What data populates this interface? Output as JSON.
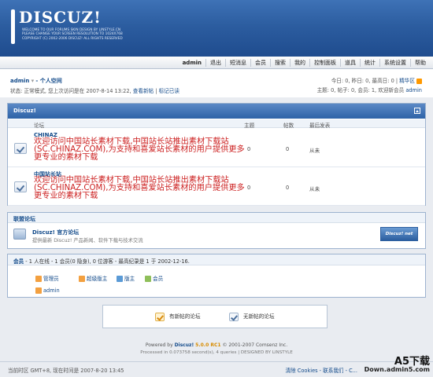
{
  "header": {
    "logo_title": "DISCUZ!",
    "logo_sub": "Welcome to our forums  Skin design by Linstyle.cn  Please change your screen resolution to 1024x768  Copyright (c) 2002-2006 Discuz! All rights reserved"
  },
  "nav": [
    "admin",
    "退出",
    "短消息",
    "会员",
    "搜索",
    "我的",
    "控制面板",
    "道具",
    "统计",
    "系统设置",
    "帮助"
  ],
  "userbar": {
    "user": "admin",
    "space": "- 个人空间",
    "status": "状态: 正常模式, 您上次访问是在 2007-8-14 13:22,",
    "link_new": "查看新帖",
    "link_read": "标记已读",
    "stats1": "今日: 0, 昨日: 0, 最高日: 0 |",
    "stats1_link": "精华区",
    "stats2": "主题: 0, 帖子: 0, 会员: 1, 欢迎新会员",
    "stats2_link": "admin"
  },
  "forum": {
    "category": "Discuz!",
    "columns": {
      "forum": "论坛",
      "topics": "主题",
      "posts": "帖数",
      "last": "最后发表"
    },
    "rows": [
      {
        "name": "CHINAZ",
        "desc": "欢迎访问中国站长素材下载,中国站长站推出素材下载站(SC.CHINAZ.COM),为支持和喜爱站长素材的用户提供更多更专业的素材下载",
        "topics": "0",
        "posts": "0",
        "last": "从未"
      },
      {
        "name": "中国站长站",
        "desc": "欢迎访问中国站长素材下载,中国站长站推出素材下载站(SC.CHINAZ.COM),为支持和喜爱站长素材的用户提供更多更专业的素材下载",
        "topics": "0",
        "posts": "0",
        "last": "从未"
      }
    ]
  },
  "league": {
    "title": "联盟论坛",
    "name": "Discuz! 官方论坛",
    "desc": "提供最新 Discuz! 产品新闻、软件下载与技术交流",
    "logo_text": "Discuz! net"
  },
  "online": {
    "label": "会员",
    "summary": "- 1 人在线 - 1 会员(0 隐身), 0 位游客 - 最高纪录是 1 于 2002-12-16.",
    "legend": [
      {
        "label": "管理员",
        "color": "#f3a040"
      },
      {
        "label": "超级版主",
        "color": "#f3a040"
      },
      {
        "label": "版主",
        "color": "#5a9ad6"
      },
      {
        "label": "会员",
        "color": "#8fbf5a"
      }
    ],
    "user": "admin"
  },
  "icon_legend": {
    "new_label": "有新帖的论坛",
    "none_label": "无新帖的论坛"
  },
  "footer": {
    "powered_pre": "Powered by",
    "powered_name": "Discuz!",
    "powered_ver": "5.0.0 RC1",
    "powered_post": "© 2001-2007 Comsenz Inc.",
    "processed": "Processed in 0.073758 second(s), 4 queries  | DESIGNED BY LINSTYLE",
    "tz": "当前时区  GMT+8, 现在时间是  2007-8-20 13:45",
    "links": "清除 Cookies - 联系我们 - C...",
    "watermark1": "A5下载",
    "watermark2": "Down.admin5.com"
  }
}
